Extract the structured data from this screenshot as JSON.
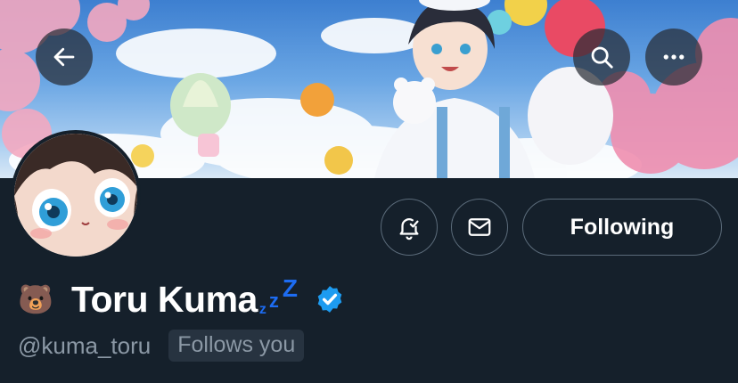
{
  "header": {
    "back_icon": "arrow-left-icon",
    "search_icon": "search-icon",
    "more_icon": "more-horizontal-icon"
  },
  "actions": {
    "notification_icon": "bell-check-icon",
    "message_icon": "envelope-icon",
    "following_label": "Following"
  },
  "profile": {
    "emoji": "🐻",
    "display_name": "Toru Kuma",
    "sleep_glyphs": [
      "z",
      "z",
      "Z"
    ],
    "verified_icon": "verified-badge-icon",
    "handle": "@kuma_toru",
    "follows_you_label": "Follows you"
  },
  "colors": {
    "background": "#15202b",
    "text_primary": "#ffffff",
    "text_secondary": "#8b98a5",
    "button_border": "#5b6b7a",
    "verified_blue": "#1d9bf0",
    "zzz_blue": "#1d6cf2",
    "badge_bg": "#273340"
  }
}
